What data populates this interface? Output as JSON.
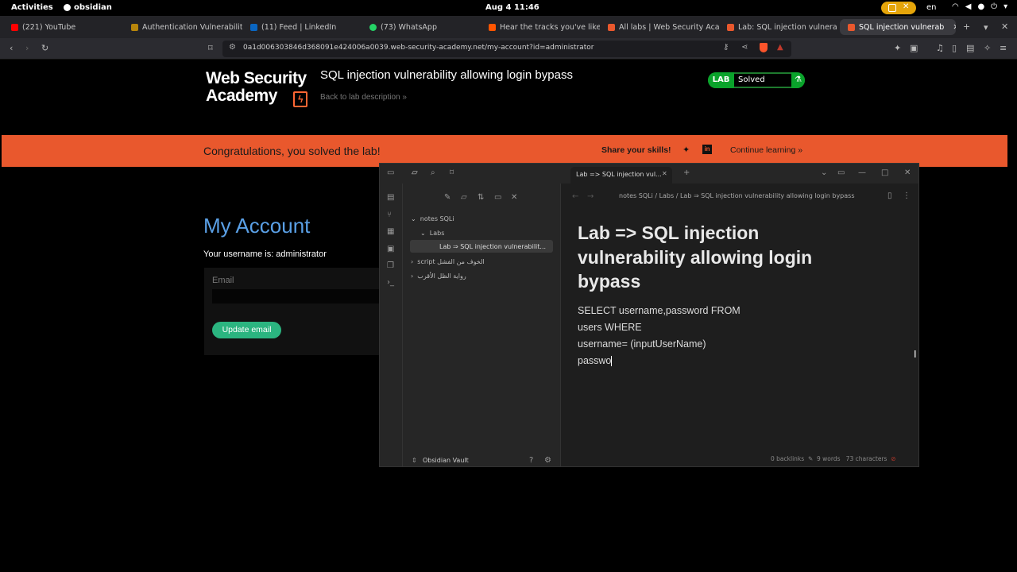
{
  "topbar": {
    "activities": "Activities",
    "app_name": "obsidian",
    "clock": "Aug 4  11:46",
    "lang": "en"
  },
  "tabs": [
    {
      "label": "(221) YouTube",
      "color": "#ff0000"
    },
    {
      "label": "Authentication Vulnerabilit",
      "color": "#b8860b"
    },
    {
      "label": "(11) Feed | LinkedIn",
      "color": "#0a66c2"
    },
    {
      "label": "(73) WhatsApp",
      "color": "#25d366"
    },
    {
      "label": "Hear the tracks you've like",
      "color": "#ff5500"
    },
    {
      "label": "All labs | Web Security Aca",
      "color": "#e9582d"
    },
    {
      "label": "Lab: SQL injection vulnera",
      "color": "#e9582d"
    },
    {
      "label": "SQL injection vulnerab",
      "color": "#e9582d"
    }
  ],
  "address_bar": {
    "url": "0a1d006303846d368091e424006a0039.web-security-academy.net/my-account?id=administrator"
  },
  "page": {
    "logo_line1": "Web Security",
    "logo_line2": "Academy",
    "lab_title": "SQL injection vulnerability allowing login bypass",
    "back_link": "Back to lab description  »",
    "badge_lab": "LAB",
    "badge_status": "Solved",
    "banner_message": "Congratulations, you solved the lab!",
    "share_label": "Share your skills!",
    "continue_label": "Continue learning »",
    "account_heading": "My Account",
    "username_text": "Your username is: administrator",
    "email_label": "Email",
    "update_button": "Update email"
  },
  "obsidian": {
    "tab_label": "Lab => SQL injection vul...",
    "breadcrumb": "notes SQLi  /  Labs  /  Lab ⇒ SQL injection vulnerability allowing login bypass",
    "tree": {
      "root": "notes SQLi",
      "labs": "Labs",
      "active_file": "Lab ⇒ SQL injection vulnerabilit...",
      "script_folder": "script الخوف من الفشل",
      "novel_folder": "رواية الظل الأقرب"
    },
    "vault_name": "Obsidian Vault",
    "note_title": "Lab => SQL injection vulnerability allowing login bypass",
    "note_lines": [
      "SELECT username,password FROM",
      "users WHERE",
      "username= (inputUserName)",
      "passwo"
    ],
    "status": {
      "backlinks": "0 backlinks",
      "words": "9 words",
      "characters": "73 characters"
    }
  }
}
